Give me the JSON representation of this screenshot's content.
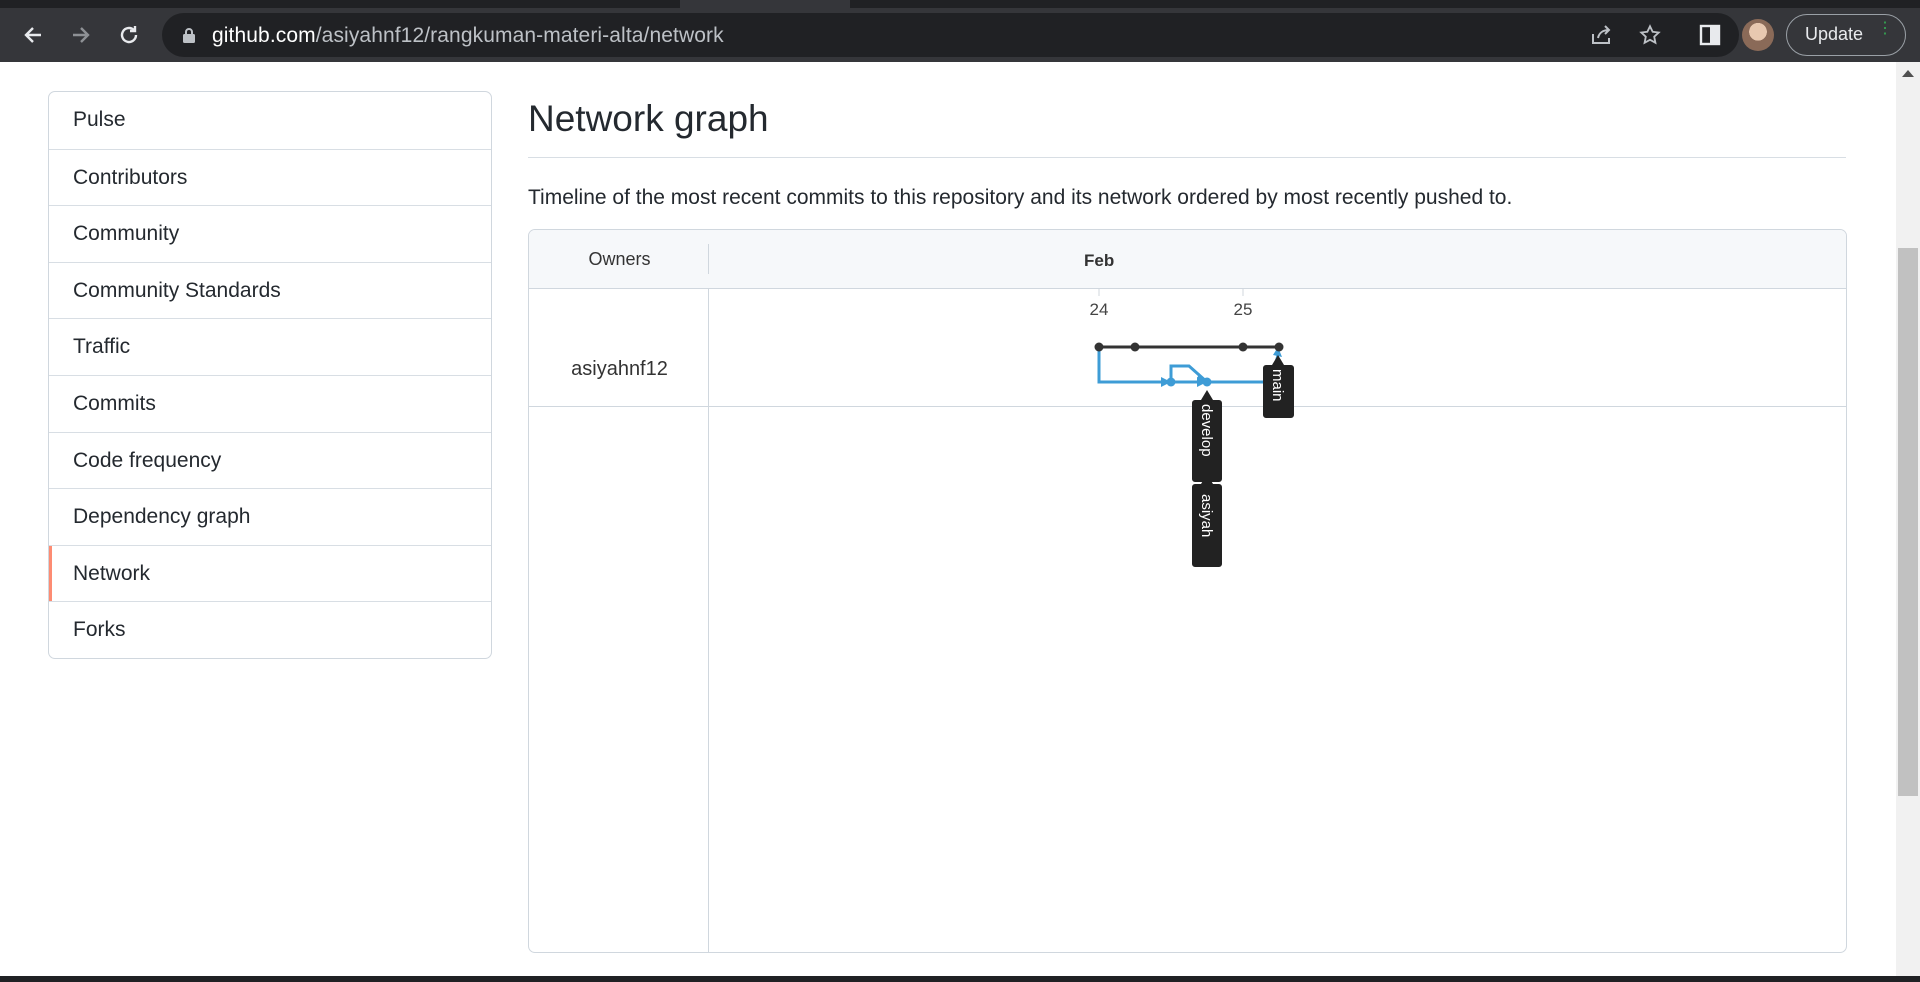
{
  "browser": {
    "url_host": "github.com",
    "url_path": "/asiyahnf12/rangkuman-materi-alta/network",
    "update_label": "Update"
  },
  "sidebar": {
    "items": [
      {
        "label": "Pulse"
      },
      {
        "label": "Contributors"
      },
      {
        "label": "Community"
      },
      {
        "label": "Community Standards"
      },
      {
        "label": "Traffic"
      },
      {
        "label": "Commits"
      },
      {
        "label": "Code frequency"
      },
      {
        "label": "Dependency graph"
      },
      {
        "label": "Network",
        "active": true
      },
      {
        "label": "Forks"
      }
    ]
  },
  "main": {
    "title": "Network graph",
    "description": "Timeline of the most recent commits to this repository and its network ordered by most recently pushed to."
  },
  "graph": {
    "owners_header": "Owners",
    "month_label": "Feb",
    "owner": "asiyahnf12",
    "days": [
      "24",
      "25"
    ],
    "branch_labels": [
      "main",
      "develop",
      "asiyah"
    ],
    "colors": {
      "main_line": "#333333",
      "branch_line": "#3e9cd6",
      "label_bg": "#222222",
      "label_text": "#ffffff"
    }
  }
}
